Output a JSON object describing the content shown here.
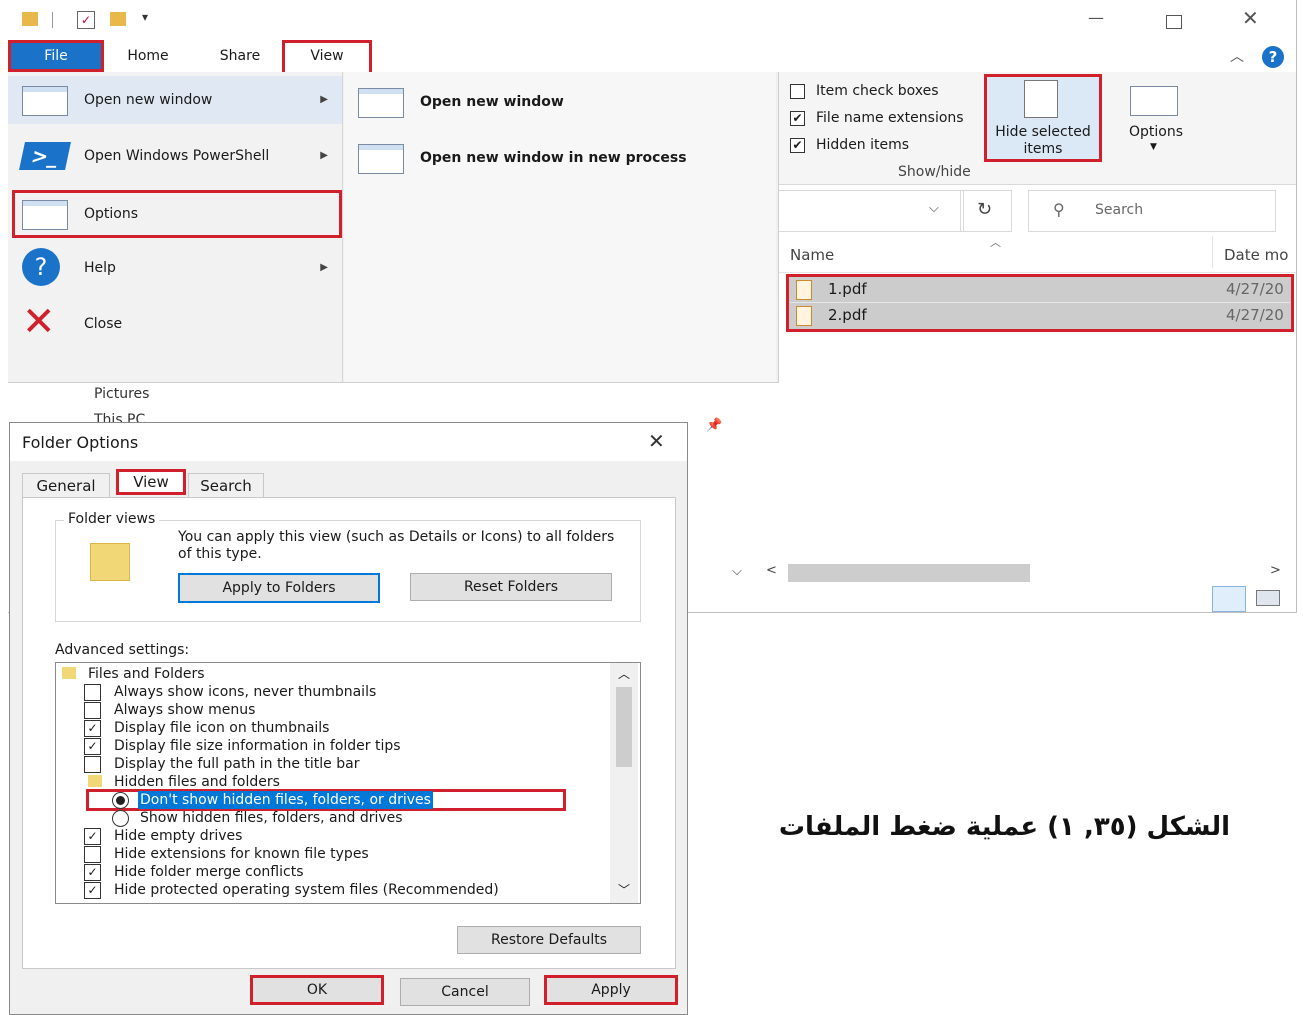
{
  "explorer": {
    "tabs": {
      "file": "File",
      "home": "Home",
      "share": "Share",
      "view": "View"
    },
    "file_menu": {
      "items": [
        {
          "label": "Open new window"
        },
        {
          "label": "Open Windows PowerShell"
        },
        {
          "label": "Options"
        },
        {
          "label": "Help"
        },
        {
          "label": "Close"
        }
      ],
      "sub_items": [
        {
          "label": "Open new window"
        },
        {
          "label": "Open new window in new process"
        }
      ]
    },
    "ribbon": {
      "checkboxes": [
        {
          "label": "Item check boxes",
          "checked": false
        },
        {
          "label": "File name extensions",
          "checked": true
        },
        {
          "label": "Hidden items",
          "checked": true
        }
      ],
      "hide_selected": "Hide selected items",
      "options": "Options",
      "group_label": "Show/hide"
    },
    "search_placeholder": "Search",
    "columns": {
      "name": "Name",
      "date": "Date mo"
    },
    "files": [
      {
        "name": "1.pdf",
        "date": "4/27/20"
      },
      {
        "name": "2.pdf",
        "date": "4/27/20"
      }
    ],
    "nav_partial": [
      "Pictures",
      "This PC"
    ]
  },
  "dialog": {
    "title": "Folder Options",
    "tabs": {
      "general": "General",
      "view": "View",
      "search": "Search"
    },
    "folder_views_label": "Folder views",
    "folder_views_text": "You can apply this view (such as Details or Icons) to all folders of this type.",
    "apply_to_folders": "Apply to Folders",
    "reset_folders": "Reset Folders",
    "advanced_label": "Advanced settings:",
    "advanced": [
      {
        "type": "folder",
        "label": "Files and Folders"
      },
      {
        "type": "check",
        "label": "Always show icons, never thumbnails",
        "checked": false
      },
      {
        "type": "check",
        "label": "Always show menus",
        "checked": false
      },
      {
        "type": "check",
        "label": "Display file icon on thumbnails",
        "checked": true
      },
      {
        "type": "check",
        "label": "Display file size information in folder tips",
        "checked": true
      },
      {
        "type": "check",
        "label": "Display the full path in the title bar",
        "checked": false
      },
      {
        "type": "folder",
        "label": "Hidden files and folders"
      },
      {
        "type": "radio",
        "label": "Don't show hidden files, folders, or drives",
        "checked": true
      },
      {
        "type": "radio",
        "label": "Show hidden files, folders, and drives",
        "checked": false
      },
      {
        "type": "check",
        "label": "Hide empty drives",
        "checked": true
      },
      {
        "type": "check",
        "label": "Hide extensions for known file types",
        "checked": false
      },
      {
        "type": "check",
        "label": "Hide folder merge conflicts",
        "checked": true
      },
      {
        "type": "check",
        "label": "Hide protected operating system files (Recommended)",
        "checked": true
      }
    ],
    "restore_defaults": "Restore Defaults",
    "ok": "OK",
    "cancel": "Cancel",
    "apply": "Apply"
  },
  "caption": "الشكل (٣٥, ١) عملية ضغط الملفات",
  "colors": {
    "accent": "#1a73c9",
    "highlight": "#c8c8c8",
    "red_box": "#d0202c",
    "selection": "#0078d7"
  }
}
